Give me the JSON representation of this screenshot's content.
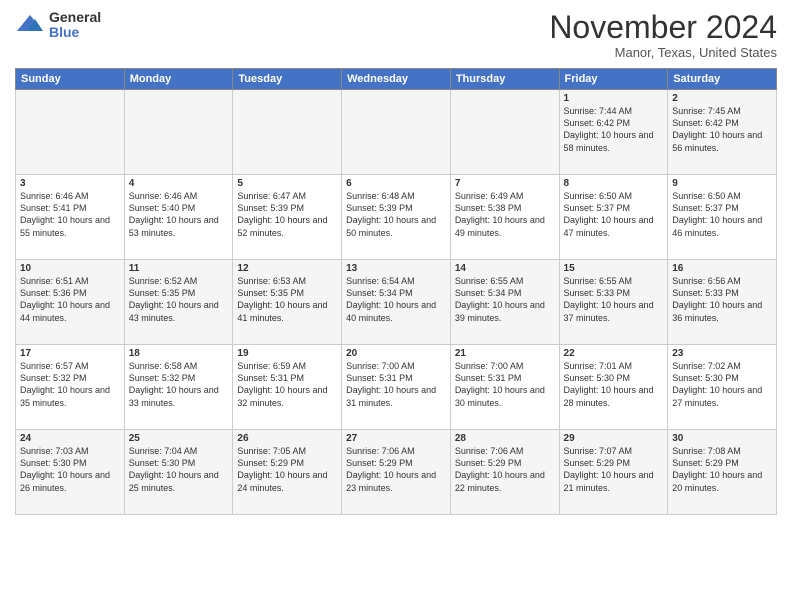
{
  "header": {
    "logo_general": "General",
    "logo_blue": "Blue",
    "month_title": "November 2024",
    "location": "Manor, Texas, United States"
  },
  "days_of_week": [
    "Sunday",
    "Monday",
    "Tuesday",
    "Wednesday",
    "Thursday",
    "Friday",
    "Saturday"
  ],
  "weeks": [
    [
      {
        "day": "",
        "info": ""
      },
      {
        "day": "",
        "info": ""
      },
      {
        "day": "",
        "info": ""
      },
      {
        "day": "",
        "info": ""
      },
      {
        "day": "",
        "info": ""
      },
      {
        "day": "1",
        "info": "Sunrise: 7:44 AM\nSunset: 6:42 PM\nDaylight: 10 hours and 58 minutes."
      },
      {
        "day": "2",
        "info": "Sunrise: 7:45 AM\nSunset: 6:42 PM\nDaylight: 10 hours and 56 minutes."
      }
    ],
    [
      {
        "day": "3",
        "info": "Sunrise: 6:46 AM\nSunset: 5:41 PM\nDaylight: 10 hours and 55 minutes."
      },
      {
        "day": "4",
        "info": "Sunrise: 6:46 AM\nSunset: 5:40 PM\nDaylight: 10 hours and 53 minutes."
      },
      {
        "day": "5",
        "info": "Sunrise: 6:47 AM\nSunset: 5:39 PM\nDaylight: 10 hours and 52 minutes."
      },
      {
        "day": "6",
        "info": "Sunrise: 6:48 AM\nSunset: 5:39 PM\nDaylight: 10 hours and 50 minutes."
      },
      {
        "day": "7",
        "info": "Sunrise: 6:49 AM\nSunset: 5:38 PM\nDaylight: 10 hours and 49 minutes."
      },
      {
        "day": "8",
        "info": "Sunrise: 6:50 AM\nSunset: 5:37 PM\nDaylight: 10 hours and 47 minutes."
      },
      {
        "day": "9",
        "info": "Sunrise: 6:50 AM\nSunset: 5:37 PM\nDaylight: 10 hours and 46 minutes."
      }
    ],
    [
      {
        "day": "10",
        "info": "Sunrise: 6:51 AM\nSunset: 5:36 PM\nDaylight: 10 hours and 44 minutes."
      },
      {
        "day": "11",
        "info": "Sunrise: 6:52 AM\nSunset: 5:35 PM\nDaylight: 10 hours and 43 minutes."
      },
      {
        "day": "12",
        "info": "Sunrise: 6:53 AM\nSunset: 5:35 PM\nDaylight: 10 hours and 41 minutes."
      },
      {
        "day": "13",
        "info": "Sunrise: 6:54 AM\nSunset: 5:34 PM\nDaylight: 10 hours and 40 minutes."
      },
      {
        "day": "14",
        "info": "Sunrise: 6:55 AM\nSunset: 5:34 PM\nDaylight: 10 hours and 39 minutes."
      },
      {
        "day": "15",
        "info": "Sunrise: 6:55 AM\nSunset: 5:33 PM\nDaylight: 10 hours and 37 minutes."
      },
      {
        "day": "16",
        "info": "Sunrise: 6:56 AM\nSunset: 5:33 PM\nDaylight: 10 hours and 36 minutes."
      }
    ],
    [
      {
        "day": "17",
        "info": "Sunrise: 6:57 AM\nSunset: 5:32 PM\nDaylight: 10 hours and 35 minutes."
      },
      {
        "day": "18",
        "info": "Sunrise: 6:58 AM\nSunset: 5:32 PM\nDaylight: 10 hours and 33 minutes."
      },
      {
        "day": "19",
        "info": "Sunrise: 6:59 AM\nSunset: 5:31 PM\nDaylight: 10 hours and 32 minutes."
      },
      {
        "day": "20",
        "info": "Sunrise: 7:00 AM\nSunset: 5:31 PM\nDaylight: 10 hours and 31 minutes."
      },
      {
        "day": "21",
        "info": "Sunrise: 7:00 AM\nSunset: 5:31 PM\nDaylight: 10 hours and 30 minutes."
      },
      {
        "day": "22",
        "info": "Sunrise: 7:01 AM\nSunset: 5:30 PM\nDaylight: 10 hours and 28 minutes."
      },
      {
        "day": "23",
        "info": "Sunrise: 7:02 AM\nSunset: 5:30 PM\nDaylight: 10 hours and 27 minutes."
      }
    ],
    [
      {
        "day": "24",
        "info": "Sunrise: 7:03 AM\nSunset: 5:30 PM\nDaylight: 10 hours and 26 minutes."
      },
      {
        "day": "25",
        "info": "Sunrise: 7:04 AM\nSunset: 5:30 PM\nDaylight: 10 hours and 25 minutes."
      },
      {
        "day": "26",
        "info": "Sunrise: 7:05 AM\nSunset: 5:29 PM\nDaylight: 10 hours and 24 minutes."
      },
      {
        "day": "27",
        "info": "Sunrise: 7:06 AM\nSunset: 5:29 PM\nDaylight: 10 hours and 23 minutes."
      },
      {
        "day": "28",
        "info": "Sunrise: 7:06 AM\nSunset: 5:29 PM\nDaylight: 10 hours and 22 minutes."
      },
      {
        "day": "29",
        "info": "Sunrise: 7:07 AM\nSunset: 5:29 PM\nDaylight: 10 hours and 21 minutes."
      },
      {
        "day": "30",
        "info": "Sunrise: 7:08 AM\nSunset: 5:29 PM\nDaylight: 10 hours and 20 minutes."
      }
    ]
  ]
}
